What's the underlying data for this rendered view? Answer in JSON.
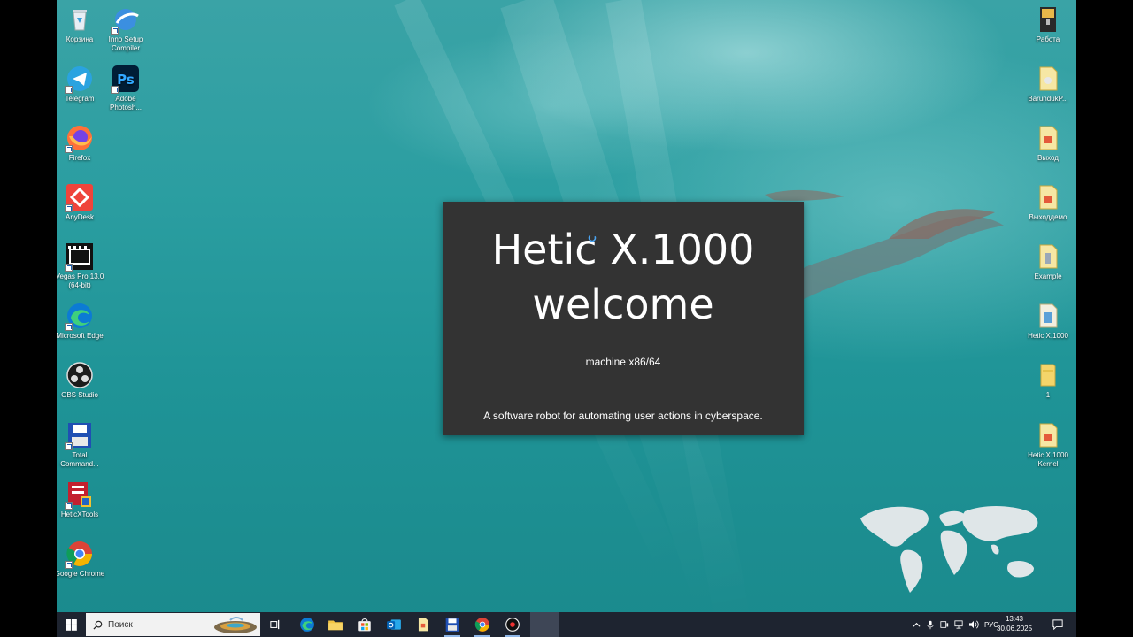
{
  "desktop": {
    "left_icons": [
      {
        "name": "recycle-bin",
        "label": "Корзина"
      },
      {
        "name": "inno-setup",
        "label": "Inno Setup Compiler"
      },
      {
        "name": "telegram",
        "label": "Telegram"
      },
      {
        "name": "photoshop",
        "label": "Adobe Photosh..."
      },
      {
        "name": "firefox",
        "label": "Firefox"
      },
      {
        "name": "anydesk",
        "label": "AnyDesk"
      },
      {
        "name": "vegas-pro",
        "label": "Vegas Pro 13.0 (64-bit)"
      },
      {
        "name": "edge",
        "label": "Microsoft Edge"
      },
      {
        "name": "obs",
        "label": "OBS Studio"
      },
      {
        "name": "total-commander",
        "label": "Total Command..."
      },
      {
        "name": "hetic-tools",
        "label": "HeticXTools"
      },
      {
        "name": "chrome",
        "label": "Google Chrome"
      }
    ],
    "right_icons": [
      {
        "name": "rabota",
        "label": "Работа"
      },
      {
        "name": "barunduk",
        "label": "BarundukP..."
      },
      {
        "name": "vyhod",
        "label": "Выход"
      },
      {
        "name": "vyhod-demo",
        "label": "Выходдемо"
      },
      {
        "name": "example",
        "label": "Example"
      },
      {
        "name": "hetic-x1000",
        "label": "Hetic X.1000"
      },
      {
        "name": "folder-1",
        "label": "1"
      },
      {
        "name": "hetic-kernel",
        "label": "Hetic X.1000 Kernel"
      }
    ]
  },
  "splash": {
    "title_line1": "Hetic X.1000",
    "title_line2": "welcome",
    "machine": "machine x86/64",
    "description": "A software robot for automating user actions in cyberspace."
  },
  "taskbar": {
    "search_placeholder": "Поиск",
    "language": "РУС",
    "time": "13:43",
    "date": "30.06.2025"
  },
  "colors": {
    "splash_bg": "#333333",
    "taskbar_bg": "#1e2430",
    "water": "#2b9ea1"
  }
}
